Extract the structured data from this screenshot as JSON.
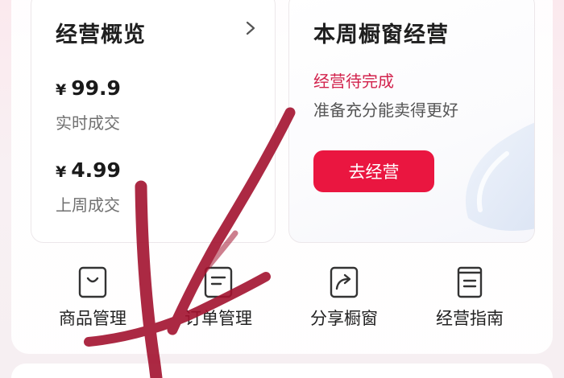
{
  "overview": {
    "title": "经营概览",
    "realtime": {
      "currency": "¥",
      "value": "99.9",
      "label": "实时成交"
    },
    "last_week": {
      "currency": "¥",
      "value": "4.99",
      "label": "上周成交"
    }
  },
  "weekly": {
    "title": "本周橱窗经营",
    "status": "经营待完成",
    "hint": "准备充分能卖得更好",
    "button_label": "去经营"
  },
  "quick_actions": [
    {
      "label": "商品管理",
      "icon": "shopping-bag-icon"
    },
    {
      "label": "订单管理",
      "icon": "order-list-icon"
    },
    {
      "label": "分享橱窗",
      "icon": "share-icon"
    },
    {
      "label": "经营指南",
      "icon": "guide-book-icon"
    }
  ],
  "colors": {
    "accent": "#ea1640",
    "status_text": "#d2224c",
    "annotation_stroke": "#a3122f"
  }
}
